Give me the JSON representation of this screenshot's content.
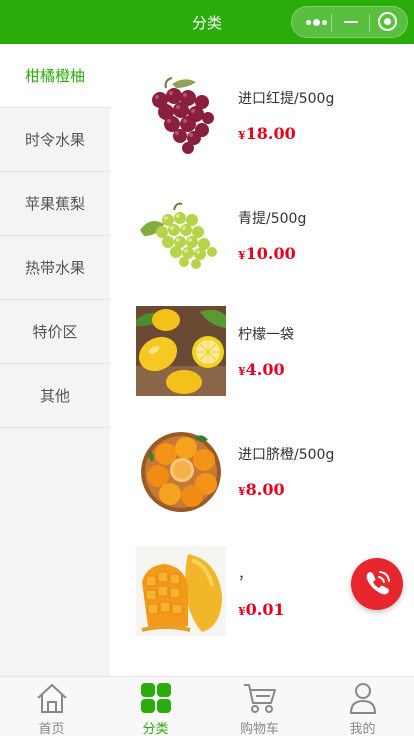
{
  "header": {
    "title": "分类"
  },
  "sidebar": {
    "items": [
      {
        "label": "柑橘橙柚",
        "active": true
      },
      {
        "label": "时令水果",
        "active": false
      },
      {
        "label": "苹果蕉梨",
        "active": false
      },
      {
        "label": "热带水果",
        "active": false
      },
      {
        "label": "特价区",
        "active": false
      },
      {
        "label": "其他",
        "active": false
      }
    ]
  },
  "products": [
    {
      "name": "进口红提/500g",
      "currency": "¥",
      "price": "18.00",
      "image": "red-grapes"
    },
    {
      "name": "青提/500g",
      "currency": "¥",
      "price": "10.00",
      "image": "green-grapes"
    },
    {
      "name": "柠檬一袋",
      "currency": "¥",
      "price": "4.00",
      "image": "lemons"
    },
    {
      "name": "进口脐橙/500g",
      "currency": "¥",
      "price": "8.00",
      "image": "navel-oranges"
    },
    {
      "name": "，",
      "currency": "¥",
      "price": "0.01",
      "image": "mango"
    }
  ],
  "floating": {
    "call_icon": "phone-icon",
    "color": "#e8262d"
  },
  "tabbar": {
    "items": [
      {
        "label": "首页",
        "icon": "home-icon",
        "active": false
      },
      {
        "label": "分类",
        "icon": "category-icon",
        "active": true
      },
      {
        "label": "购物车",
        "icon": "cart-icon",
        "active": false
      },
      {
        "label": "我的",
        "icon": "user-icon",
        "active": false
      }
    ]
  },
  "colors": {
    "brand": "#2aad0a",
    "price": "#e6001e"
  }
}
